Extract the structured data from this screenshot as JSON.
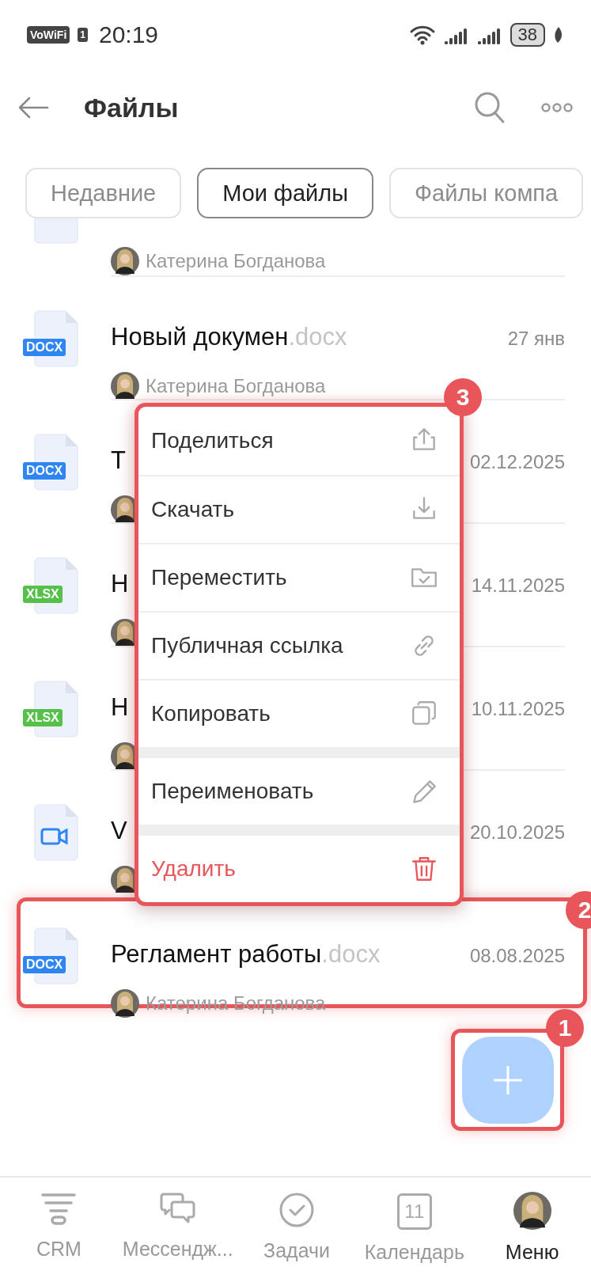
{
  "status_bar": {
    "network_badge": "VoWiFi",
    "sim": "1",
    "time": "20:19",
    "battery": "38"
  },
  "header": {
    "title": "Файлы"
  },
  "tabs": [
    {
      "label": "Недавние",
      "selected": false
    },
    {
      "label": "Мои файлы",
      "selected": true
    },
    {
      "label": "Файлы компа",
      "selected": false
    }
  ],
  "files": [
    {
      "kind": "docx",
      "author": "Катерина Богданова",
      "highlighted": false
    },
    {
      "kind": "docx",
      "badge": "DOCX",
      "name": "Новый докумен",
      "ext": ".docx",
      "date": "27 янв",
      "author": "Катерина Богданова",
      "highlighted": false
    },
    {
      "kind": "docx",
      "badge": "DOCX",
      "name": "Т",
      "date": "02.12.2025",
      "highlighted": false
    },
    {
      "kind": "xlsx",
      "badge": "XLSX",
      "name": "Н",
      "date": "14.11.2025",
      "highlighted": false
    },
    {
      "kind": "xlsx",
      "badge": "XLSX",
      "name": "Н",
      "date": "10.11.2025",
      "highlighted": false
    },
    {
      "kind": "video",
      "name": "V",
      "date": "20.10.2025",
      "highlighted": false
    },
    {
      "kind": "docx",
      "badge": "DOCX",
      "name": "Регламент работы",
      "ext": ".docx",
      "date": "08.08.2025",
      "author": "Катерина Богданова",
      "highlighted": true,
      "callout": "2"
    }
  ],
  "context_menu": {
    "callout": "3",
    "items": [
      {
        "label": "Поделиться",
        "kind": "share",
        "section_start": false,
        "danger": false
      },
      {
        "label": "Скачать",
        "kind": "download",
        "section_start": false,
        "danger": false
      },
      {
        "label": "Переместить",
        "kind": "folder",
        "section_start": false,
        "danger": false
      },
      {
        "label": "Публичная ссылка",
        "kind": "link",
        "section_start": false,
        "danger": false
      },
      {
        "label": "Копировать",
        "kind": "copy",
        "section_start": false,
        "danger": false
      },
      {
        "label": "Переименовать",
        "kind": "pencil",
        "section_start": true,
        "danger": false
      },
      {
        "label": "Удалить",
        "kind": "trash",
        "section_start": true,
        "danger": true
      }
    ]
  },
  "add_button": {
    "callout": "1"
  },
  "bottom_nav": [
    {
      "label": "CRM",
      "kind": "funnel",
      "selected": false
    },
    {
      "label": "Мессендж...",
      "kind": "chat",
      "selected": false
    },
    {
      "label": "Задачи",
      "kind": "check",
      "selected": false
    },
    {
      "label": "Календарь",
      "kind": "calendar",
      "icon_text": "11",
      "selected": false
    },
    {
      "label": "Меню",
      "kind": "avatar",
      "selected": true
    }
  ]
}
